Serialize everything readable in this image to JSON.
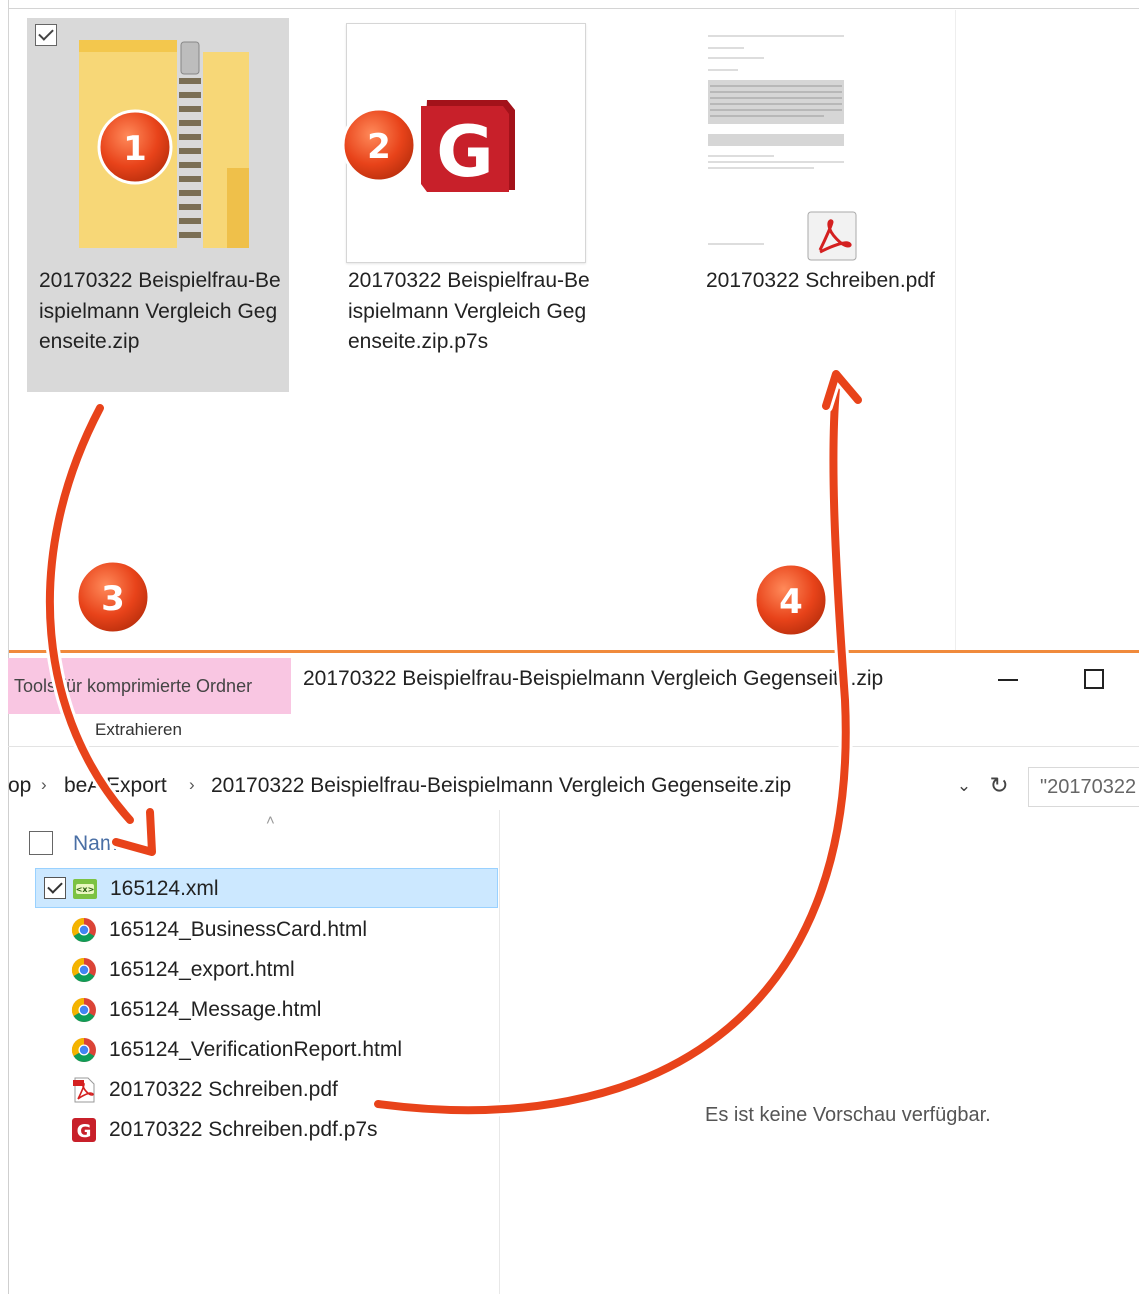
{
  "top_files": [
    {
      "label": "20170322 Beispielfrau-Beispielmann Vergleich Gegenseite.zip",
      "icon": "zip-folder-icon",
      "selected": true
    },
    {
      "label": "20170322 Beispielfrau-Beispielmann Vergleich Gegenseite.zip.p7s",
      "icon": "signature-g-icon",
      "selected": false
    },
    {
      "label": "20170322 Schreiben.pdf",
      "icon": "pdf-thumbnail-icon",
      "selected": false
    }
  ],
  "window": {
    "tools_tab": "Tools für komprimierte Ordner",
    "extract_tab": "Extrahieren",
    "title": "20170322 Beispielfrau-Beispielmann Vergleich Gegenseite.zip",
    "breadcrumb": [
      "op",
      "beA Export",
      "20170322 Beispielfrau-Beispielmann Vergleich Gegenseite.zip"
    ],
    "search_placeholder": "\"20170322"
  },
  "list": {
    "column_name": "Name",
    "rows": [
      {
        "name": "165124.xml",
        "icon": "xml-icon",
        "selected": true
      },
      {
        "name": "165124_BusinessCard.html",
        "icon": "chrome-icon",
        "selected": false
      },
      {
        "name": "165124_export.html",
        "icon": "chrome-icon",
        "selected": false
      },
      {
        "name": "165124_Message.html",
        "icon": "chrome-icon",
        "selected": false
      },
      {
        "name": "165124_VerificationReport.html",
        "icon": "chrome-icon",
        "selected": false
      },
      {
        "name": "20170322 Schreiben.pdf",
        "icon": "pdf-icon",
        "selected": false
      },
      {
        "name": "20170322 Schreiben.pdf.p7s",
        "icon": "signature-g-icon",
        "selected": false
      }
    ]
  },
  "preview_message": "Es ist keine Vorschau verfügbar.",
  "steps": [
    "1",
    "2",
    "3",
    "4"
  ],
  "colors": {
    "accent_orange": "#e8431a",
    "selection_blue": "#cce8ff",
    "tools_pink": "#f9c6e2"
  }
}
